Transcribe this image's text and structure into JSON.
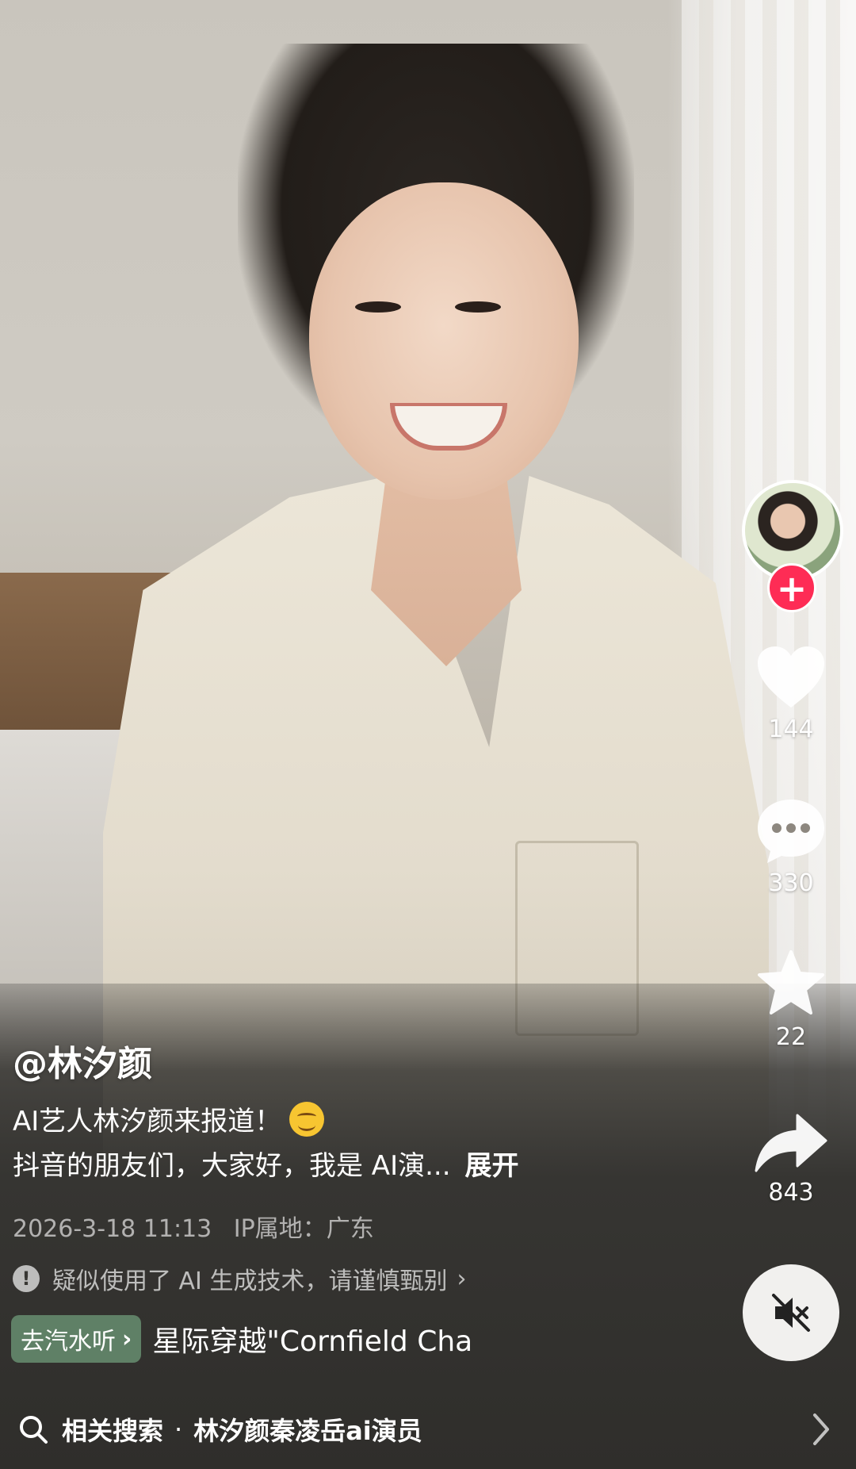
{
  "video": {
    "author_handle": "@林汐颜",
    "caption_line1": "AI艺人林汐颜来报道！",
    "caption_line2": "抖音的朋友们，大家好，我是 AI演...",
    "expand_label": "展开",
    "date": "2026-3-18 11:13",
    "ip_location": "IP属地：广东",
    "ai_notice": "疑似使用了 AI 生成技术，请谨慎甄别"
  },
  "music": {
    "chip_label": "去汽水听",
    "title": "星际穿越\"Cornfield Cha"
  },
  "actions": {
    "likes": "144",
    "comments": "330",
    "favorites": "22",
    "shares": "843",
    "follow_symbol": "+"
  },
  "related_search": {
    "label": "相关搜索",
    "separator": "·",
    "query": "林汐颜秦凌岳ai演员"
  },
  "icons": {
    "follow": "plus-icon",
    "like": "heart-icon",
    "comment": "comment-bubble-icon",
    "favorite": "star-icon",
    "share": "share-arrow-icon",
    "mute": "speaker-muted-icon",
    "warning": "exclamation-circle-icon",
    "search": "search-icon",
    "chevron": "chevron-right-icon"
  },
  "colors": {
    "follow_button": "#fe2c55",
    "music_chip": "#5f8066"
  }
}
